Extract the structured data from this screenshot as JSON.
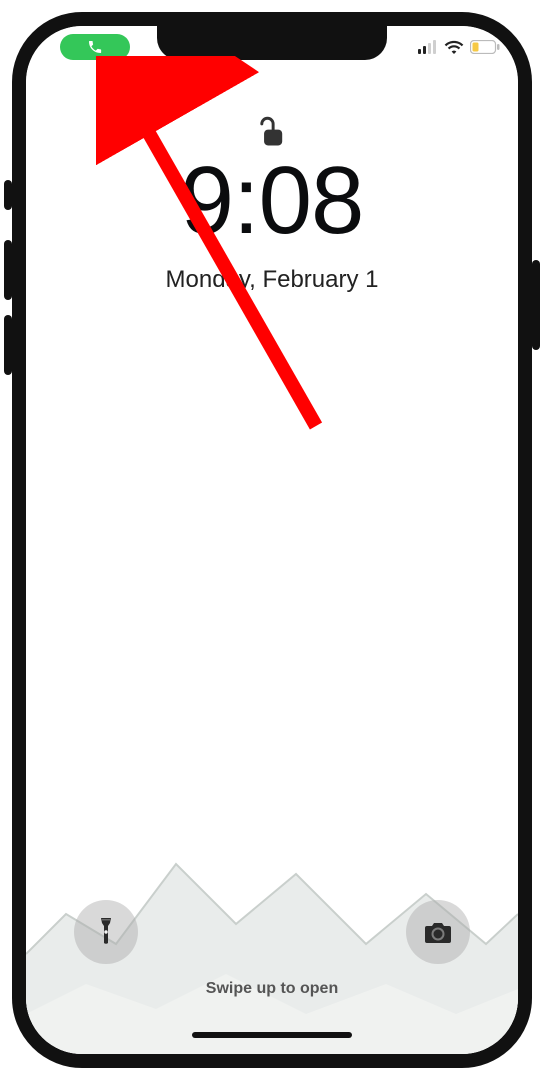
{
  "status": {
    "call_active": true,
    "call_pill_color": "#34c759"
  },
  "lock_state": "unlocked",
  "time": "9:08",
  "date": "Monday, February 1",
  "hint": "Swipe up to open",
  "annotation": {
    "type": "arrow",
    "color": "#ff0000",
    "points_to": "call-pill"
  }
}
